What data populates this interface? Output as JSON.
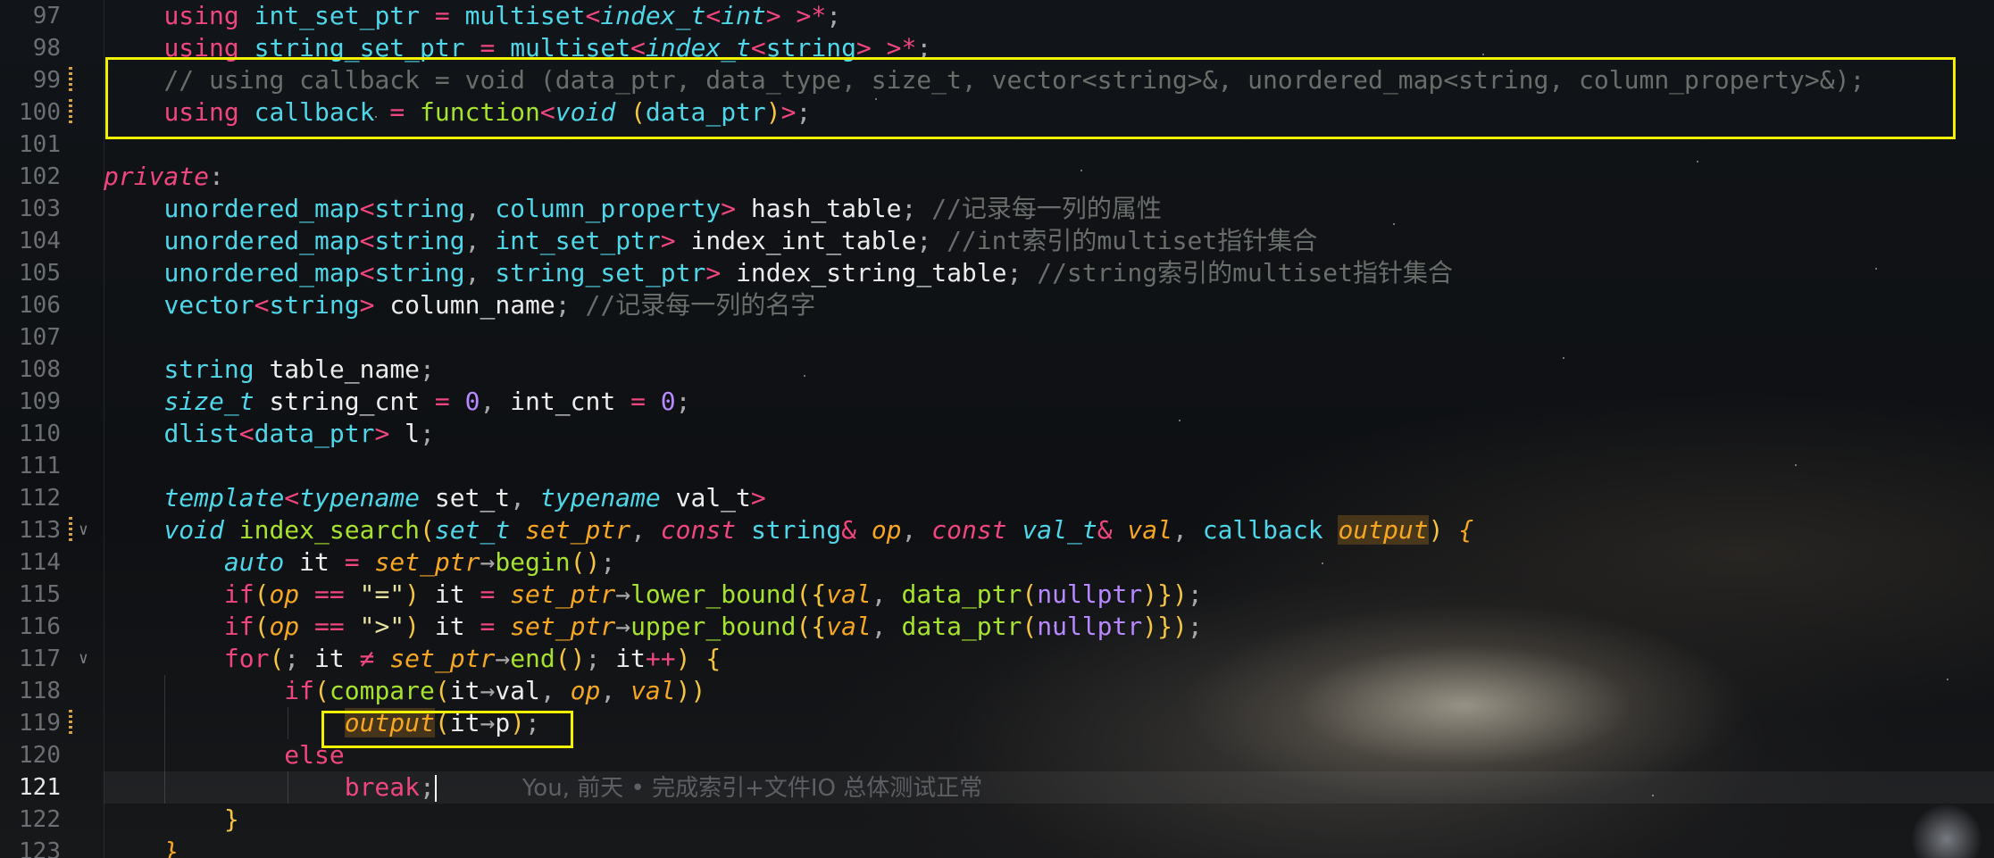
{
  "editor": {
    "first_line_number": 97,
    "current_line": "121",
    "line_numbers": [
      "97",
      "98",
      "99",
      "100",
      "101",
      "102",
      "103",
      "104",
      "105",
      "106",
      "107",
      "108",
      "109",
      "110",
      "111",
      "112",
      "113",
      "114",
      "115",
      "116",
      "117",
      "118",
      "119",
      "120",
      "121",
      "122",
      "123"
    ]
  },
  "code": {
    "l97": {
      "kw": "using",
      "name": "int_set_ptr",
      "eq": "=",
      "ty": "multiset",
      "lt": "<",
      "inner": "index_t",
      "lt2": "<",
      "arg": "int",
      "gt": ">",
      "sp": " ",
      "gt2": ">",
      "star": "*",
      "semi": ";"
    },
    "l98": {
      "kw": "using",
      "name": "string_set_ptr",
      "eq": "=",
      "ty": "multiset",
      "lt": "<",
      "inner": "index_t",
      "lt2": "<",
      "arg": "string",
      "gt": ">",
      "sp": " ",
      "gt2": ">",
      "star": "*",
      "semi": ";"
    },
    "l99": {
      "comment": "// using callback = void (data_ptr, data_type, size_t, vector<string>&, unordered_map<string, column_property>&);"
    },
    "l100": {
      "kw": "using",
      "name": "callback",
      "eq": "=",
      "ty": "function",
      "lt": "<",
      "ret": "void",
      "lp": "(",
      "arg": "data_ptr",
      "rp": ")",
      "gt": ">",
      "semi": ";"
    },
    "l102": {
      "kw": "private",
      "colon": ":"
    },
    "l103": {
      "ty": "unordered_map",
      "lt": "<",
      "a1": "string",
      "comma": ",",
      "a2": "column_property",
      "gt": ">",
      "name": "hash_table",
      "semi": ";",
      "comment": "//记录每一列的属性"
    },
    "l104": {
      "ty": "unordered_map",
      "lt": "<",
      "a1": "string",
      "comma": ",",
      "a2": "int_set_ptr",
      "gt": ">",
      "name": "index_int_table",
      "semi": ";",
      "comment": "//int索引的multiset指针集合"
    },
    "l105": {
      "ty": "unordered_map",
      "lt": "<",
      "a1": "string",
      "comma": ",",
      "a2": "string_set_ptr",
      "gt": ">",
      "name": "index_string_table",
      "semi": ";",
      "comment": "//string索引的multiset指针集合"
    },
    "l106": {
      "ty": "vector",
      "lt": "<",
      "a1": "string",
      "gt": ">",
      "name": "column_name",
      "semi": ";",
      "comment": "//记录每一列的名字"
    },
    "l108": {
      "ty": "string",
      "name": "table_name",
      "semi": ";"
    },
    "l109": {
      "ty": "size_t",
      "n1": "string_cnt",
      "eq1": "=",
      "v1": "0",
      "comma": ",",
      "n2": "int_cnt",
      "eq2": "=",
      "v2": "0",
      "semi": ";"
    },
    "l110": {
      "ty": "dlist",
      "lt": "<",
      "a1": "data_ptr",
      "gt": ">",
      "name": "l",
      "semi": ";"
    },
    "l112": {
      "kw": "template",
      "lt": "<",
      "tn1": "typename",
      "p1": "set_t",
      "comma": ",",
      "tn2": "typename",
      "p2": "val_t",
      "gt": ">"
    },
    "l113": {
      "ret": "void",
      "fn": "index_search",
      "lp": "(",
      "t1": "set_t",
      "p1": "set_ptr",
      "c1": ",",
      "k2": "const",
      "t2": "string",
      "amp2": "&",
      "p2": "op",
      "c2": ",",
      "k3": "const",
      "t3": "val_t",
      "amp3": "&",
      "p3": "val",
      "c3": ",",
      "t4": "callback",
      "p4": "output",
      "rp": ")",
      "lb": "{"
    },
    "l114": {
      "kw": "auto",
      "name": "it",
      "eq": "=",
      "obj": "set_ptr",
      "arrow": "→",
      "fn": "begin",
      "call": "()",
      "semi": ";"
    },
    "l115": {
      "kw": "if",
      "lp": "(",
      "p": "op",
      "eqeq": "==",
      "s": "\"=\"",
      "rp": ")",
      "name": "it",
      "eq": "=",
      "obj": "set_ptr",
      "arrow": "→",
      "fn": "lower_bound",
      "open": "({",
      "v": "val",
      "comma": ",",
      "ty": "data_ptr",
      "lp2": "(",
      "null": "nullptr",
      "close": ")})",
      "semi": ";"
    },
    "l116": {
      "kw": "if",
      "lp": "(",
      "p": "op",
      "eqeq": "==",
      "s": "\">\"",
      "rp": ")",
      "name": "it",
      "eq": "=",
      "obj": "set_ptr",
      "arrow": "→",
      "fn": "upper_bound",
      "open": "({",
      "v": "val",
      "comma": ",",
      "ty": "data_ptr",
      "lp2": "(",
      "null": "nullptr",
      "close": ")})",
      "semi": ";"
    },
    "l117": {
      "kw": "for",
      "lp": "(",
      "semi1": ";",
      "name": "it",
      "neq": "≠",
      "obj": "set_ptr",
      "arrow": "→",
      "fn": "end",
      "call": "()",
      "semi2": ";",
      "name2": "it",
      "inc": "++",
      "rp": ")",
      "lb": "{"
    },
    "l118": {
      "kw": "if",
      "lp": "(",
      "fn": "compare",
      "lp2": "(",
      "a": "it",
      "arrow": "→",
      "m": "val",
      "c1": ",",
      "p1": "op",
      "c2": ",",
      "p2": "val",
      "rp": "))"
    },
    "l119": {
      "fn": "output",
      "lp": "(",
      "a": "it",
      "arrow": "→",
      "m": "p",
      "rp": ")",
      "semi": ";"
    },
    "l120": {
      "kw": "else"
    },
    "l121": {
      "kw": "break",
      "semi": ";",
      "blame": "You, 前天 • 完成索引+文件IO 总体测试正常"
    },
    "l122": {
      "rb": "}"
    },
    "l123": {
      "rb": "}"
    }
  },
  "colors": {
    "keyword": "#f0467e",
    "type": "#4fd6e8",
    "function": "#a6e22e",
    "parameter": "#f5a623",
    "number": "#b788ff",
    "comment": "#6a6e6a",
    "highlight_box": "#f2f200"
  }
}
